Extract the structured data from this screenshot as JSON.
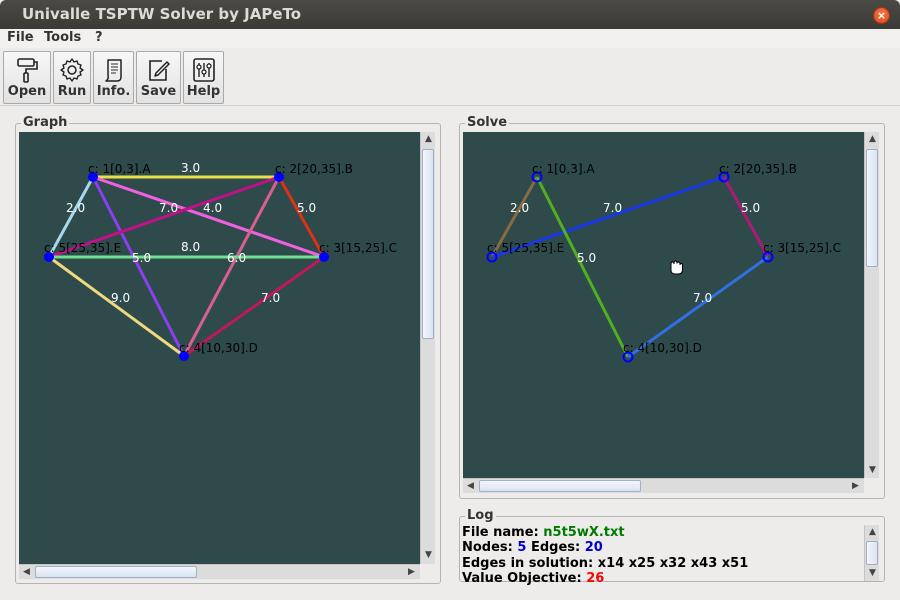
{
  "window": {
    "title": "Univalle TSPTW Solver by JAPeTo",
    "close_glyph": "×"
  },
  "menu": {
    "items": [
      "File",
      "Tools",
      "?"
    ]
  },
  "toolbar": {
    "buttons": [
      {
        "label": "Open",
        "icon": "paint-roller-icon"
      },
      {
        "label": "Run",
        "icon": "gear-icon"
      },
      {
        "label": "Info.",
        "icon": "document-scroll-icon"
      },
      {
        "label": "Save",
        "icon": "edit-note-icon"
      },
      {
        "label": "Help",
        "icon": "sliders-icon"
      }
    ]
  },
  "graph_panel": {
    "title": "Graph",
    "nodes": [
      "c: 1[0,3].A",
      "c: 2[20,35].B",
      "c: 3[15,25].C",
      "c: 4[10,30].D",
      "c: 5[25,35].E"
    ],
    "edge_labels": [
      "3.0",
      "2.0",
      "7.0",
      "9.0",
      "4.0",
      "5.0",
      "8.0",
      "5.0",
      "6.0",
      "9.0",
      "7.0"
    ]
  },
  "solve_panel": {
    "title": "Solve",
    "nodes": [
      "c: 1[0,3].A",
      "c: 2[20,35].B",
      "c: 3[15,25].C",
      "c: 4[10,30].D",
      "c: 5[25,35].E"
    ],
    "edge_labels": [
      "2.0",
      "7.0",
      "5.0",
      "5.0",
      "7.0"
    ]
  },
  "log": {
    "title": "Log",
    "file_label": "File name:",
    "file_value": "n5t5wX.txt",
    "nodes_label": "Nodes:",
    "nodes_value": "5",
    "edges_label": "Edges:",
    "edges_value": "20",
    "solution_label": "Edges in solution:",
    "solution_value": "x14 x25 x32 x43 x51",
    "objective_label": "Value Objective:",
    "objective_value": "26"
  },
  "colors": {
    "canvas_bg": "#2E4A4A",
    "node": "#0000FF",
    "file_value": "#007A00",
    "number_value": "#0000CC",
    "objective_value": "#FF0000"
  }
}
